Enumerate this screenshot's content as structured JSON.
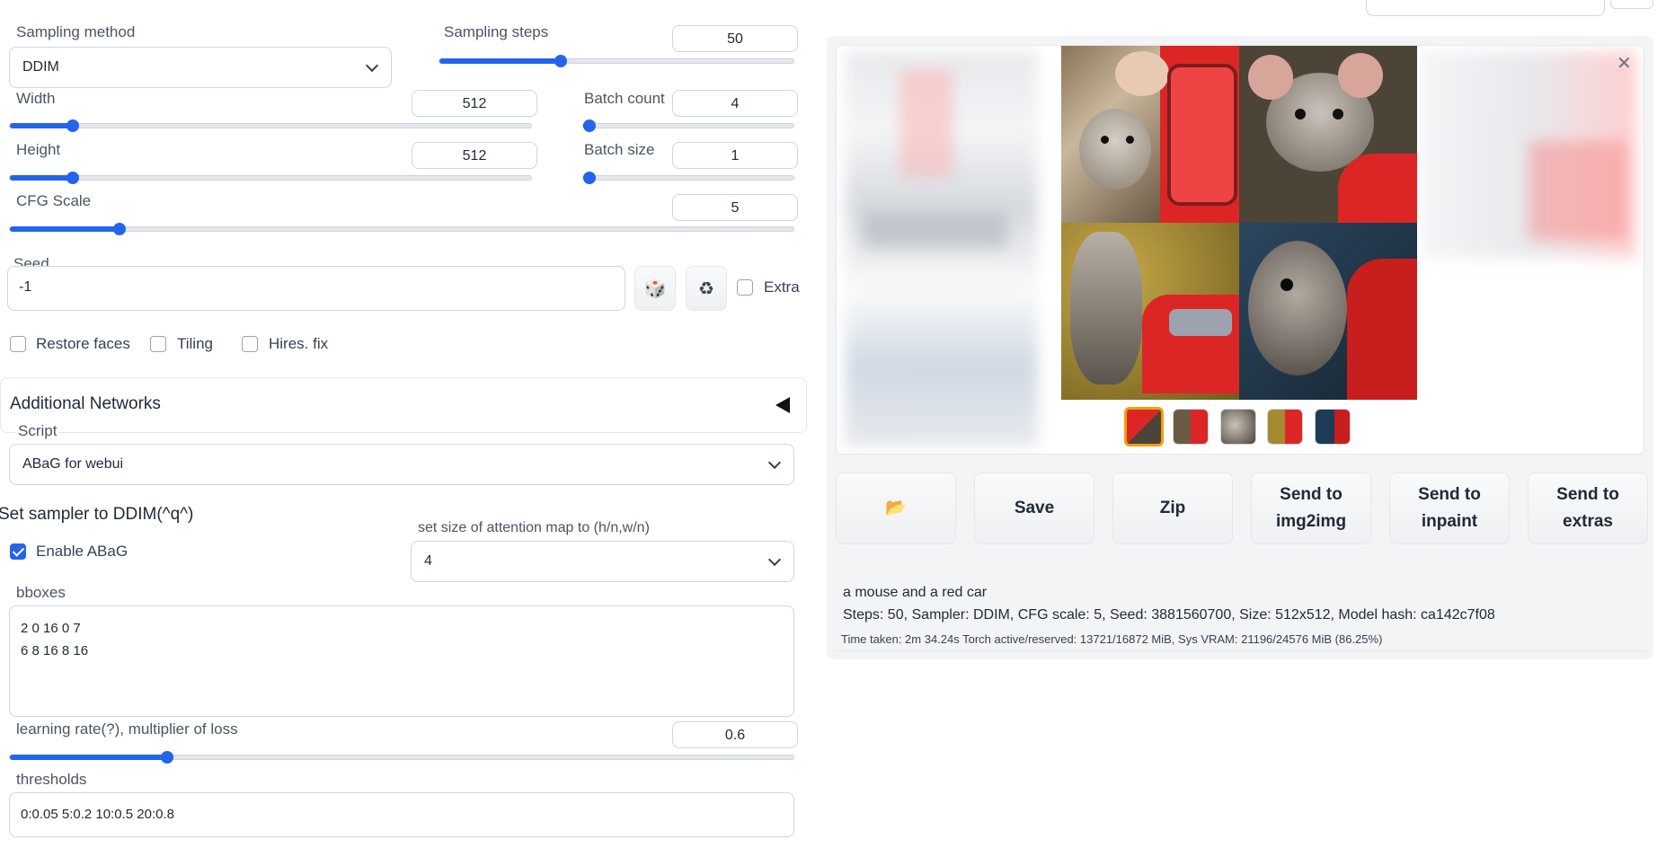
{
  "sampling": {
    "method_label": "Sampling method",
    "method_value": "DDIM",
    "steps_label": "Sampling steps",
    "steps_value": "50",
    "steps_fraction": 0.34
  },
  "width": {
    "label": "Width",
    "value": "512",
    "fraction": 0.12
  },
  "height": {
    "label": "Height",
    "value": "512",
    "fraction": 0.12
  },
  "batch_count": {
    "label": "Batch count",
    "value": "4",
    "fraction": 0.02
  },
  "batch_size": {
    "label": "Batch size",
    "value": "1",
    "fraction": 0.0
  },
  "cfg": {
    "label": "CFG Scale",
    "value": "5",
    "fraction": 0.14
  },
  "seed": {
    "label": "Seed",
    "value": "-1",
    "dice_icon": "dice-icon",
    "recycle_icon": "recycle-icon",
    "extra_label": "Extra"
  },
  "options": {
    "restore_faces": "Restore faces",
    "tiling": "Tiling",
    "hires_fix": "Hires. fix"
  },
  "additional_networks": {
    "title": "Additional Networks"
  },
  "script": {
    "label": "Script",
    "value": "ABaG for webui"
  },
  "abag": {
    "heading": "Set sampler to DDIM(^q^)",
    "enable_label": "Enable ABaG",
    "enable_checked": true,
    "attention_label": "set size of attention map to (h/n,w/n)",
    "attention_value": "4",
    "bboxes_label": "bboxes",
    "bboxes_value": "2 0 16 0 7\n6 8 16 8 16",
    "lr_label": "learning rate(?), multiplier of loss",
    "lr_value": "0.6",
    "lr_fraction": 0.2,
    "thresholds_label": "thresholds",
    "thresholds_value": "0:0.05 5:0.2 10:0.5 20:0.8"
  },
  "output": {
    "close_icon": "close-icon",
    "buttons": {
      "folder_icon": "📂",
      "save": "Save",
      "zip": "Zip",
      "send_img2img": "Send to img2img",
      "send_inpaint": "Send to inpaint",
      "send_extras": "Send to extras"
    },
    "prompt": "a mouse and a red car",
    "params": "Steps: 50, Sampler: DDIM, CFG scale: 5, Seed: 3881560700, Size: 512x512, Model hash: ca142c7f08",
    "timing": "Time taken: 2m 34.24s  Torch active/reserved: 13721/16872 MiB, Sys VRAM: 21196/24576 MiB (86.25%)"
  },
  "colors": {
    "accent": "#2563eb",
    "selected_thumb": "#f59e0b"
  }
}
